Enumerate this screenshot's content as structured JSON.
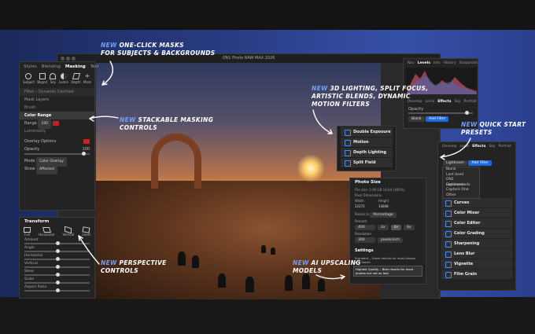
{
  "annotations": {
    "masks": {
      "new": "NEW",
      "text": "one-click masks",
      "line2": "for subjects & backgrounds"
    },
    "stackable": {
      "new": "NEW",
      "text": "stackable masking",
      "line2": "controls"
    },
    "lighting": {
      "new": "NEW",
      "text": "3D Lighting, Split Focus,",
      "line2": "Artistic Blends, Dynamic",
      "line3": "Motion Filters"
    },
    "quickstart": {
      "new": "NEW",
      "text": "quick start",
      "line2": "presets"
    },
    "perspective": {
      "new": "NEW",
      "text": "perspective",
      "line2": "controls"
    },
    "upscaling": {
      "new": "NEW",
      "text": "AI upscaling",
      "line2": "models"
    }
  },
  "window": {
    "title": "ON1 Photo RAW MAX 2026"
  },
  "masking_panel": {
    "tabs": [
      "Styles",
      "Blending",
      "Masking",
      "Text"
    ],
    "active_tab": "Masking",
    "tools": [
      "Subject",
      "Bkgnd",
      "Sky",
      "Lumin",
      "Depth",
      "More"
    ],
    "filter_label": "Filter – Dynamic Contrast",
    "mask_layers_label": "Mask Layers",
    "layers": [
      "Brush",
      "Color Range",
      "Luminosity"
    ],
    "range_label": "Range",
    "range_value": "100",
    "overlay_options": "Overlay Options",
    "opacity_label": "Opacity",
    "opacity_value": "100",
    "mode_label": "Mode",
    "mode_value": "Color Overlay",
    "show_label": "Show",
    "show_value": "Affected"
  },
  "transform_panel": {
    "title": "Transform",
    "modes": [
      "Full",
      "Horizontal",
      "Vertical",
      "Level"
    ],
    "sliders": [
      "Amount",
      "Angle",
      "Horizontal",
      "Vertical",
      "Skew",
      "Scale",
      "Aspect Ratio"
    ]
  },
  "effects_popup": {
    "items": [
      "Double Exposure",
      "Motion",
      "Depth Lighting",
      "Split Field"
    ]
  },
  "photo_size": {
    "title": "Photo Size",
    "file_size": "File size: 2.46 GB 16-bit (400%)",
    "pixel_dimensions": "Pixel Dimensions",
    "width_label": "Width",
    "height_label": "Height",
    "width": "22272",
    "height": "14848",
    "resize_label": "Resize to",
    "resize_value": "Percentage",
    "percent_label": "Percent",
    "percent_value": "400",
    "scale_options": [
      "2x",
      "4x",
      "6x"
    ],
    "resolution_label": "Resolution",
    "resolution_value": "300",
    "resolution_unit": "pixels/inch",
    "settings": "Settings",
    "standard": "Standard – Great results for most photos and faster.",
    "highest": "Highest Quality – Best results for most photos but not as fast."
  },
  "histogram_panel": {
    "tabs": [
      "Nav",
      "Levels",
      "Info",
      "History",
      "Snapshots"
    ],
    "active_tab": "Levels",
    "module_tabs": [
      "Develop",
      "Local",
      "Effects",
      "Sky",
      "Portrait"
    ],
    "opacity_label": "Opacity",
    "preset_value": "Blank",
    "add_filter": "Add Filter"
  },
  "effects_panel": {
    "tabs": [
      "Develop",
      "Local",
      "Effects",
      "Sky",
      "Portrait"
    ],
    "active_tab": "Effects",
    "preset_value": "Lightroom",
    "add_filter": "Add Filter",
    "menu": [
      "Blank",
      "Last Used",
      "ON1 Recommends",
      "Lightroom",
      "Capture One",
      "Other"
    ],
    "filters": [
      "Curves",
      "Color Mixer",
      "Color Editor",
      "Color Grading",
      "Sharpening",
      "Lens Blur",
      "Vignette",
      "Film Grain"
    ],
    "partial": [
      "Contrast"
    ]
  },
  "colors": {
    "accent": "#1d6ae0",
    "highlight": "#6ea0ff",
    "panel": "#232323"
  }
}
